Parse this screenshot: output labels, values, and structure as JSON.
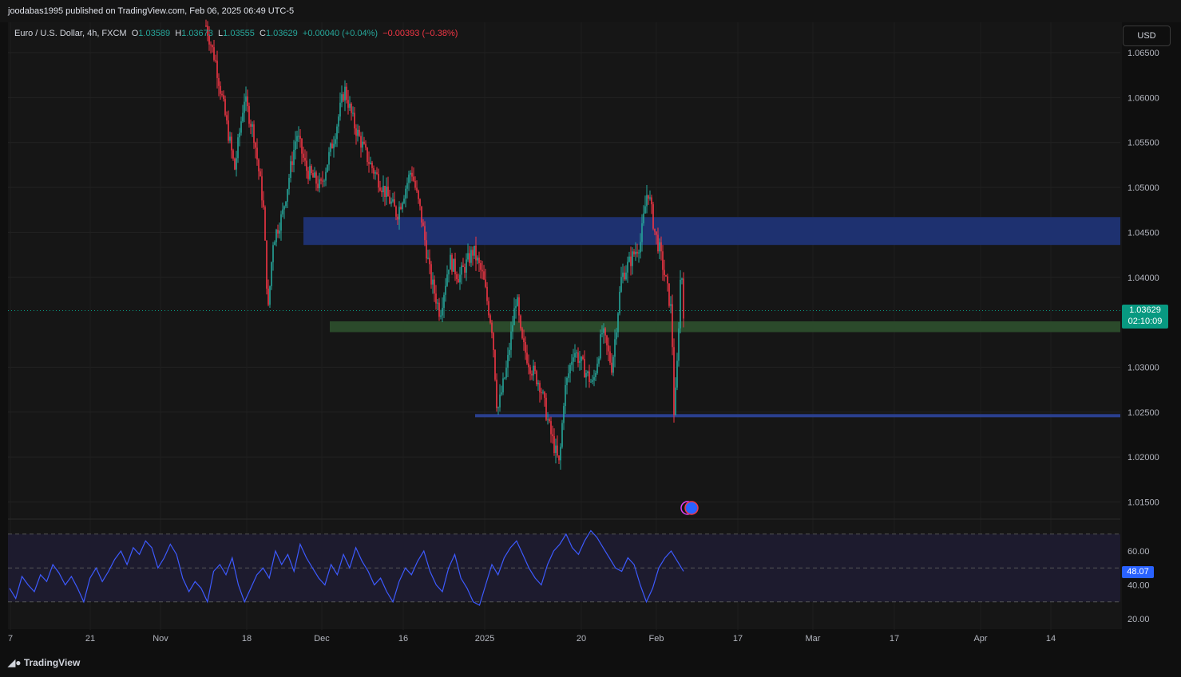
{
  "header": {
    "publisher_line": "joodabas1995 published on TradingView.com, Feb 06, 2025 06:49 UTC-5"
  },
  "legend": {
    "symbol": "Euro / U.S. Dollar, 4h, FXCM",
    "o_label": "O",
    "o_value": "1.03589",
    "h_label": "H",
    "h_value": "1.03673",
    "l_label": "L",
    "l_value": "1.03555",
    "c_label": "C",
    "c_value": "1.03629",
    "change": "+0.00040 (+0.04%)",
    "change2": "−0.00393 (−0.38%)"
  },
  "currency_button": "USD",
  "current_price": {
    "value": "1.03629",
    "countdown": "02:10:09"
  },
  "rsi_value": "48.07",
  "footer": {
    "brand": "TradingView"
  },
  "colors": {
    "up": "#26a69a",
    "down": "#f23645",
    "supply_zone": "#1e3170",
    "demand_zone": "#2b4a2b",
    "support_line": "#2a3f8f",
    "rsi_line": "#3d5afe",
    "rsi_band": "#1d1b2e"
  },
  "chart_data": [
    {
      "type": "candlestick",
      "symbol": "EURUSD",
      "timeframe": "4h",
      "y_ticks": [
        "1.06500",
        "1.06000",
        "1.05500",
        "1.05000",
        "1.04500",
        "1.04000",
        "1.03000",
        "1.02500",
        "1.02000",
        "1.01500"
      ],
      "ylim": [
        1.0128,
        1.0686
      ],
      "x_ticks": [
        "7",
        "21",
        "Nov",
        "18",
        "Dec",
        "16",
        "2025",
        "20",
        "Feb",
        "17",
        "Mar",
        "17",
        "Apr",
        "14"
      ],
      "price_path": [
        [
          0.0,
          1.068
        ],
        [
          0.02,
          1.064
        ],
        [
          0.04,
          1.058
        ],
        [
          0.06,
          1.052
        ],
        [
          0.08,
          1.06
        ],
        [
          0.1,
          1.056
        ],
        [
          0.12,
          1.048
        ],
        [
          0.13,
          1.036
        ],
        [
          0.14,
          1.044
        ],
        [
          0.16,
          1.047
        ],
        [
          0.19,
          1.056
        ],
        [
          0.21,
          1.052
        ],
        [
          0.24,
          1.05
        ],
        [
          0.27,
          1.056
        ],
        [
          0.29,
          1.061
        ],
        [
          0.31,
          1.057
        ],
        [
          0.34,
          1.053
        ],
        [
          0.37,
          1.05
        ],
        [
          0.4,
          1.047
        ],
        [
          0.43,
          1.052
        ],
        [
          0.45,
          1.047
        ],
        [
          0.47,
          1.04
        ],
        [
          0.49,
          1.036
        ],
        [
          0.51,
          1.042
        ],
        [
          0.53,
          1.04
        ],
        [
          0.56,
          1.043
        ],
        [
          0.58,
          1.04
        ],
        [
          0.6,
          1.034
        ],
        [
          0.61,
          1.025
        ],
        [
          0.63,
          1.03
        ],
        [
          0.65,
          1.038
        ],
        [
          0.66,
          1.033
        ],
        [
          0.68,
          1.03
        ],
        [
          0.7,
          1.028
        ],
        [
          0.72,
          1.023
        ],
        [
          0.74,
          1.019
        ],
        [
          0.75,
          1.027
        ],
        [
          0.77,
          1.032
        ],
        [
          0.79,
          1.03
        ],
        [
          0.81,
          1.028
        ],
        [
          0.83,
          1.034
        ],
        [
          0.85,
          1.03
        ],
        [
          0.87,
          1.04
        ],
        [
          0.89,
          1.042
        ],
        [
          0.91,
          1.044
        ],
        [
          0.925,
          1.05
        ],
        [
          0.94,
          1.045
        ],
        [
          0.95,
          1.043
        ],
        [
          0.965,
          1.039
        ],
        [
          0.975,
          1.036
        ],
        [
          0.98,
          1.025
        ],
        [
          0.985,
          1.028
        ],
        [
          0.99,
          1.035
        ],
        [
          0.995,
          1.042
        ],
        [
          1.0,
          1.03629
        ]
      ],
      "supply_zone": [
        1.0436,
        1.0467
      ],
      "demand_zone": [
        1.0339,
        1.0351
      ],
      "support_line": 1.0246,
      "last_price": 1.03629
    },
    {
      "type": "line",
      "indicator": "RSI",
      "y_ticks": [
        "60.00",
        "40.00",
        "20.00"
      ],
      "ylim": [
        17,
        83
      ],
      "bands": [
        30,
        50,
        70
      ],
      "values": [
        38,
        32,
        45,
        40,
        36,
        46,
        42,
        52,
        47,
        40,
        45,
        38,
        30,
        44,
        50,
        42,
        48,
        55,
        60,
        52,
        62,
        58,
        66,
        62,
        50,
        56,
        64,
        58,
        44,
        36,
        42,
        38,
        30,
        48,
        52,
        46,
        56,
        40,
        30,
        38,
        46,
        50,
        44,
        60,
        52,
        58,
        48,
        64,
        56,
        50,
        44,
        40,
        52,
        46,
        58,
        50,
        62,
        54,
        48,
        40,
        44,
        36,
        30,
        42,
        50,
        46,
        54,
        60,
        48,
        40,
        36,
        50,
        58,
        44,
        38,
        30,
        28,
        40,
        52,
        46,
        56,
        62,
        66,
        58,
        50,
        44,
        40,
        52,
        60,
        64,
        70,
        62,
        58,
        66,
        72,
        68,
        62,
        56,
        50,
        48,
        56,
        52,
        40,
        30,
        38,
        50,
        56,
        60,
        54,
        48.07
      ]
    }
  ]
}
